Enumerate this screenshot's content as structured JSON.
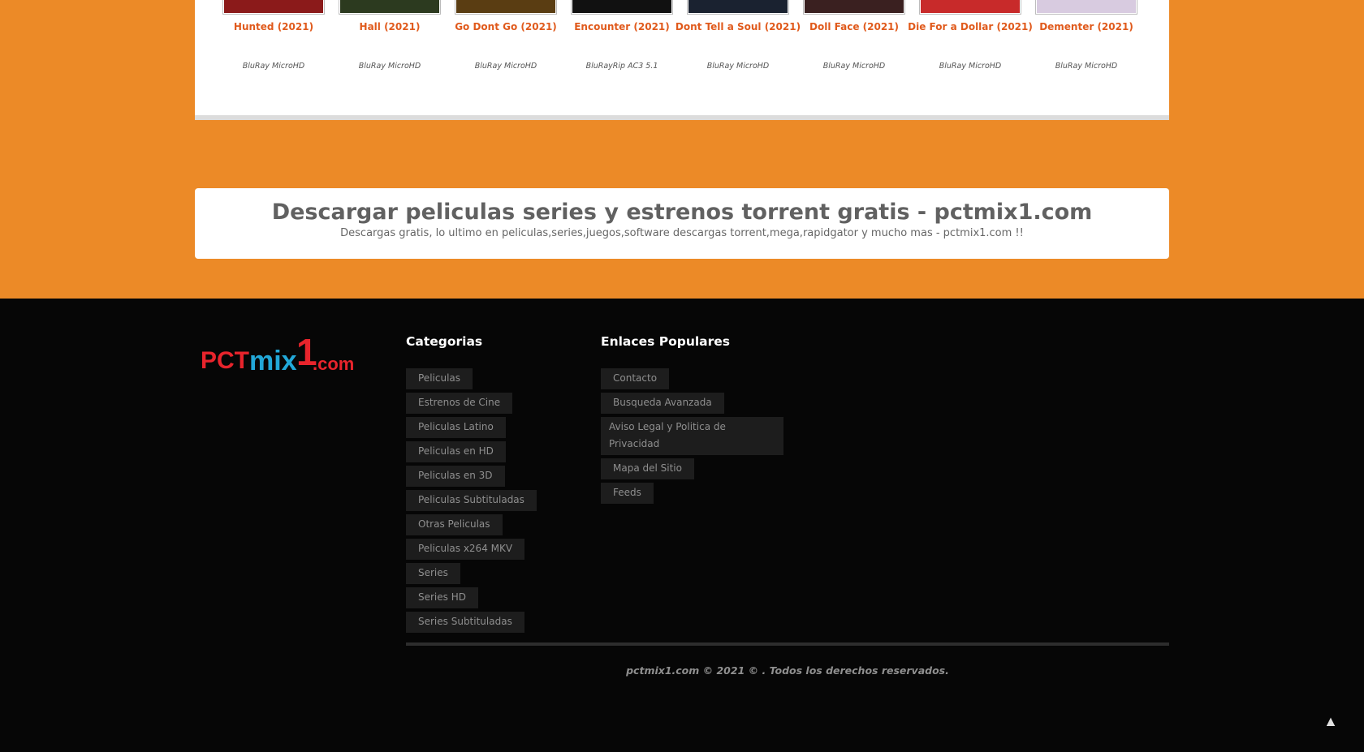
{
  "movies": [
    {
      "title": "Hunted (2021)",
      "quality": "BluRay MicroHD",
      "poster_color": "#8b1a1a"
    },
    {
      "title": "Hall (2021)",
      "quality": "BluRay MicroHD",
      "poster_color": "#2c3a1f"
    },
    {
      "title": "Go Dont Go (2021)",
      "quality": "BluRay MicroHD",
      "poster_color": "#5a3d12"
    },
    {
      "title": "Encounter (2021)",
      "quality": "BluRayRip AC3 5.1",
      "poster_color": "#111111"
    },
    {
      "title": "Dont Tell a Soul (2021)",
      "quality": "BluRay MicroHD",
      "poster_color": "#1a2230"
    },
    {
      "title": "Doll Face (2021)",
      "quality": "BluRay MicroHD",
      "poster_color": "#3a2020"
    },
    {
      "title": "Die For a Dollar (2021)",
      "quality": "BluRay MicroHD",
      "poster_color": "#c82a2a"
    },
    {
      "title": "Dementer (2021)",
      "quality": "BluRay MicroHD",
      "poster_color": "#d8cbe0"
    }
  ],
  "site": {
    "heading": "Descargar peliculas series y estrenos torrent gratis - pctmix1.com",
    "subheading": "Descargas gratis, lo ultimo en peliculas,series,juegos,software descargas torrent,mega,rapidgator y mucho mas - pctmix1.com !!"
  },
  "footer": {
    "logo_text": "PCTmix1.com",
    "categories_heading": "Categorias",
    "categories": [
      "Peliculas",
      "Estrenos de Cine",
      "Peliculas Latino",
      "Peliculas en HD",
      "Peliculas en 3D",
      "Peliculas Subtituladas",
      "Otras Peliculas",
      "Peliculas x264 MKV",
      "Series",
      "Series HD",
      "Series Subtituladas"
    ],
    "links_heading": "Enlaces Populares",
    "links": [
      "Contacto",
      "Busqueda Avanzada",
      "Aviso Legal y Politica de Privacidad",
      "Mapa del Sitio",
      "Feeds"
    ],
    "copyright": "pctmix1.com © 2021 © . Todos los derechos reservados."
  },
  "colors": {
    "accent_orange": "#ec8a27",
    "title_orange": "#e05a1c",
    "footer_bg": "#060606"
  }
}
